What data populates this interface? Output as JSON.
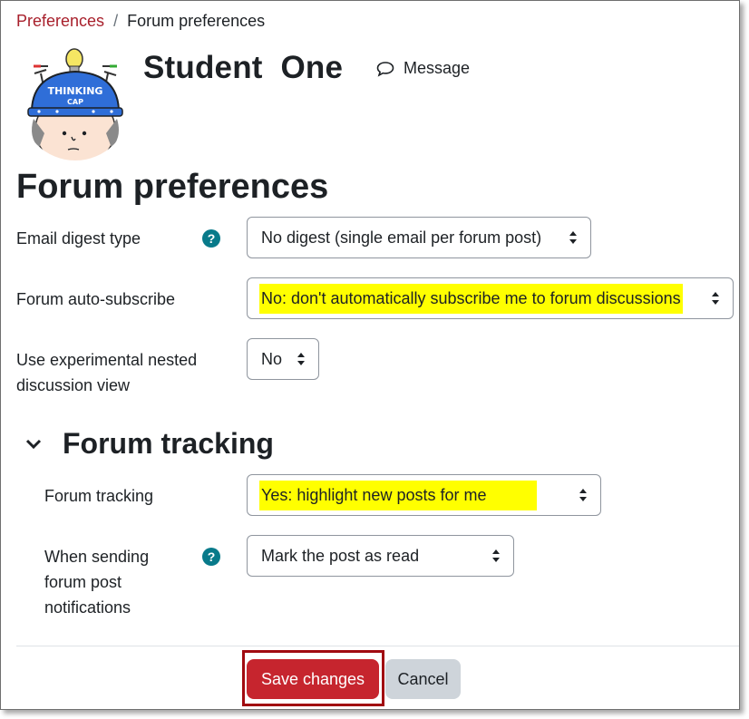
{
  "breadcrumb": {
    "items": [
      {
        "label": "Preferences",
        "link": true
      },
      {
        "label": "Forum preferences",
        "link": false
      }
    ],
    "separator": "/"
  },
  "user": {
    "name": "Student  One",
    "message_label": "Message",
    "avatar_text_1": "THINKING",
    "avatar_text_2": "CAP"
  },
  "page": {
    "title": "Forum preferences"
  },
  "fields": {
    "email_digest": {
      "label": "Email digest type",
      "value": "No digest (single email per forum post)",
      "has_help": true
    },
    "auto_subscribe": {
      "label": "Forum auto-subscribe",
      "value": "No: don't automatically subscribe me to forum discussions",
      "highlighted": true
    },
    "nested_view": {
      "label_line1": "Use experimental nested",
      "label_line2": "discussion view",
      "value": "No"
    }
  },
  "tracking_section": {
    "title": "Forum tracking",
    "expanded": true,
    "fields": {
      "forum_tracking": {
        "label": "Forum tracking",
        "value": "Yes: highlight new posts for me",
        "highlighted": true
      },
      "notifications": {
        "label_line1": "When sending",
        "label_line2": "forum post",
        "label_line3": "notifications",
        "value": "Mark the post as read",
        "has_help": true
      }
    }
  },
  "help_glyph": "?",
  "actions": {
    "save_label": "Save changes",
    "cancel_label": "Cancel"
  },
  "colors": {
    "brand": "#a8202c",
    "primary_button": "#c6252e",
    "secondary_button": "#ced4da",
    "help_icon": "#087a8a",
    "highlight": "#ffff00",
    "annotation_outline": "#a10b11"
  },
  "icons": {
    "message": "speech-bubble-icon",
    "help": "question-circle-icon",
    "select_arrows": "sort-arrows-icon",
    "section_toggle": "chevron-down-icon"
  }
}
